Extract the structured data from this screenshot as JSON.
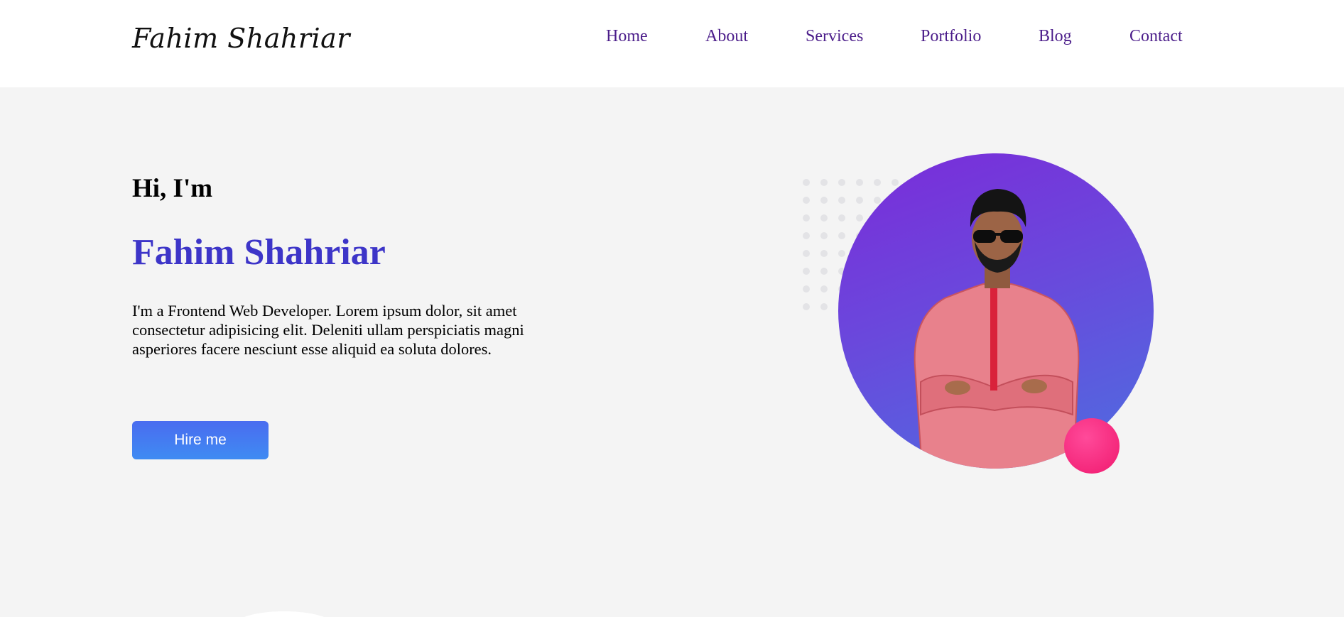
{
  "header": {
    "logo": "Fahim Shahriar",
    "nav": [
      {
        "label": "Home"
      },
      {
        "label": "About"
      },
      {
        "label": "Services"
      },
      {
        "label": "Portfolio"
      },
      {
        "label": "Blog"
      },
      {
        "label": "Contact"
      }
    ]
  },
  "hero": {
    "greeting": "Hi, I'm",
    "name": "Fahim Shahriar",
    "description": "I'm a Frontend Web Developer. Lorem ipsum dolor, sit amet consectetur adipisicing elit. Deleniti ullam perspiciatis magni asperiores facere nesciunt esse aliquid ea soluta dolores.",
    "hire_label": "Hire me"
  },
  "colors": {
    "nav_link": "#4b1d8a",
    "name": "#3d35c8",
    "button": "#4a6cf0",
    "circle_top": "#7b2bd9",
    "circle_bottom": "#4d6ee0",
    "accent_pink": "#f0196e"
  },
  "icons": [
    "profile-photo"
  ]
}
